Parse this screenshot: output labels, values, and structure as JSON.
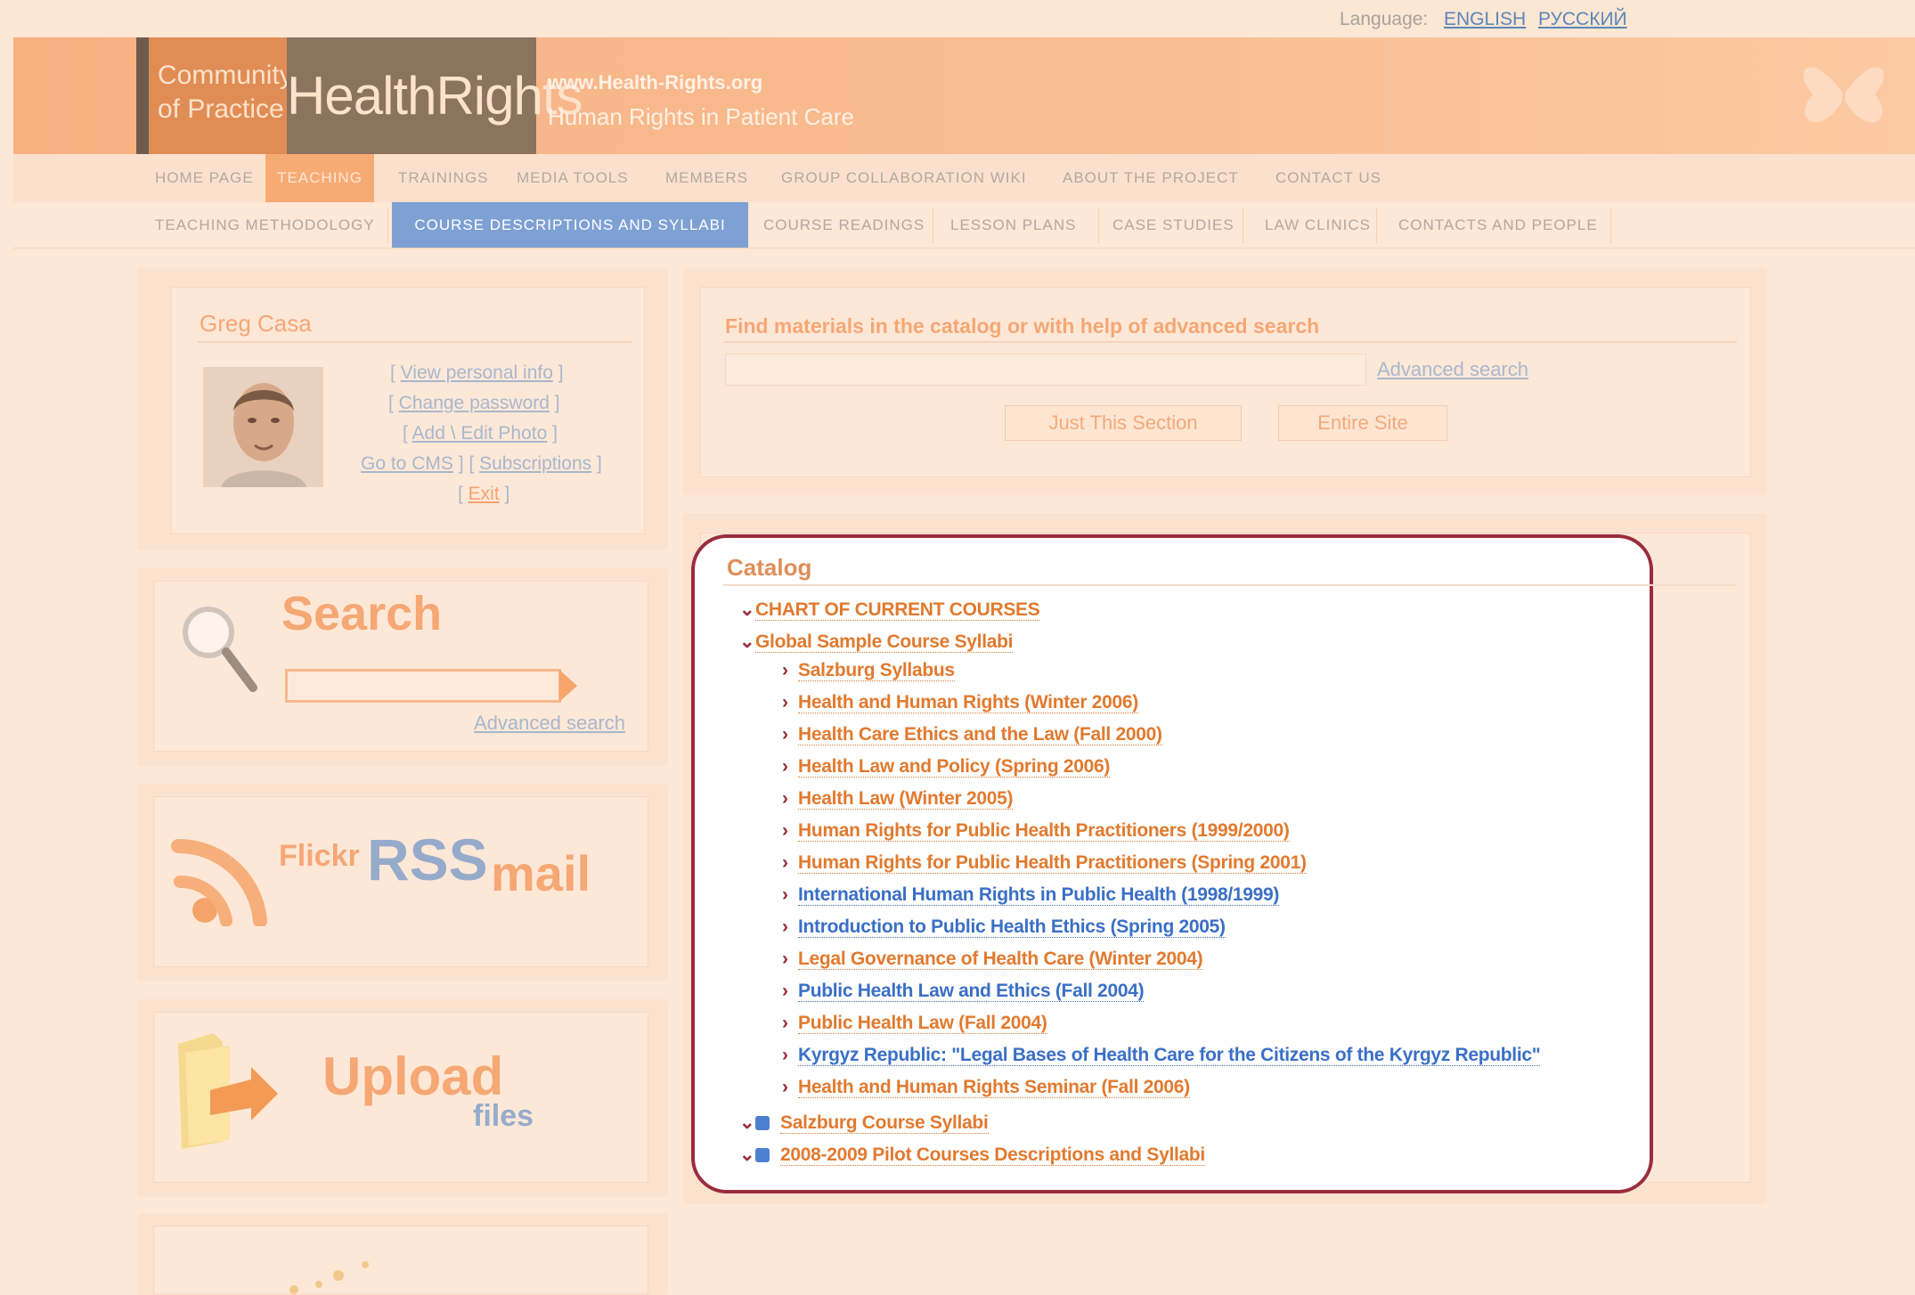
{
  "language": {
    "label": "Language:",
    "english": "ENGLISH",
    "russian": "РУССКИЙ"
  },
  "header": {
    "cop": "Community of Practice",
    "brand": "HealthRights",
    "url": "www.Health-Rights.org",
    "tagline": "Human Rights in Patient Care"
  },
  "nav_main": [
    "HOME PAGE",
    "TEACHING",
    "TRAININGS",
    "MEDIA TOOLS",
    "MEMBERS",
    "GROUP COLLABORATION WIKI",
    "ABOUT THE PROJECT",
    "CONTACT US"
  ],
  "nav_sub": [
    "TEACHING METHODOLOGY",
    "COURSE DESCRIPTIONS AND SYLLABI",
    "COURSE READINGS",
    "LESSON PLANS",
    "CASE STUDIES",
    "LAW CLINICS",
    "CONTACTS AND PEOPLE"
  ],
  "user": {
    "name": "Greg Casa",
    "view_info": "View personal info",
    "change_password": "Change password",
    "edit_photo": "Add \\ Edit Photo",
    "go_cms": "Go to CMS",
    "subscriptions": "Subscriptions",
    "exit": "Exit"
  },
  "search_widget": {
    "title": "Search",
    "advanced": "Advanced search"
  },
  "feeds": {
    "flickr": "Flickr",
    "rss": "RSS",
    "mail": "mail"
  },
  "upload": {
    "title": "Upload",
    "sub": "files"
  },
  "find": {
    "title": "Find materials in the catalog or with help of advanced search",
    "advanced": "Advanced search",
    "btn_section": "Just This Section",
    "btn_site": "Entire Site"
  },
  "catalog": {
    "title": "Catalog",
    "items": [
      {
        "level": 0,
        "text": "CHART OF CURRENT COURSES",
        "color": "orange"
      },
      {
        "level": 0,
        "text": "Global Sample Course Syllabi",
        "color": "orange"
      },
      {
        "level": 1,
        "text": "Salzburg Syllabus",
        "color": "orange"
      },
      {
        "level": 1,
        "text": "Health and Human Rights (Winter 2006)",
        "color": "orange"
      },
      {
        "level": 1,
        "text": "Health Care Ethics and the Law (Fall 2000)",
        "color": "orange"
      },
      {
        "level": 1,
        "text": "Health Law and Policy (Spring 2006)",
        "color": "orange"
      },
      {
        "level": 1,
        "text": "Health Law (Winter 2005)",
        "color": "orange"
      },
      {
        "level": 1,
        "text": "Human Rights for Public Health Practitioners (1999/2000)",
        "color": "orange"
      },
      {
        "level": 1,
        "text": "Human Rights for Public Health Practitioners (Spring 2001)",
        "color": "orange"
      },
      {
        "level": 1,
        "text": "International Human Rights in Public Health (1998/1999)",
        "color": "blue"
      },
      {
        "level": 1,
        "text": "Introduction to Public Health Ethics (Spring 2005)",
        "color": "blue"
      },
      {
        "level": 1,
        "text": "Legal Governance of Health Care (Winter 2004)",
        "color": "orange"
      },
      {
        "level": 1,
        "text": "Public Health Law and Ethics (Fall 2004)",
        "color": "blue"
      },
      {
        "level": 1,
        "text": "Public Health Law (Fall 2004)",
        "color": "orange"
      },
      {
        "level": 1,
        "text": "Kyrgyz Republic: \"Legal Bases of Health Care for the Citizens of the Kyrgyz Republic\"",
        "color": "blue"
      },
      {
        "level": 1,
        "text": "Health and Human Rights Seminar (Fall 2006)",
        "color": "orange"
      },
      {
        "level": 0,
        "text": "Salzburg Course Syllabi",
        "color": "orange",
        "db": true
      },
      {
        "level": 0,
        "text": "2008-2009 Pilot Courses Descriptions and Syllabi",
        "color": "orange",
        "db": true
      }
    ]
  }
}
